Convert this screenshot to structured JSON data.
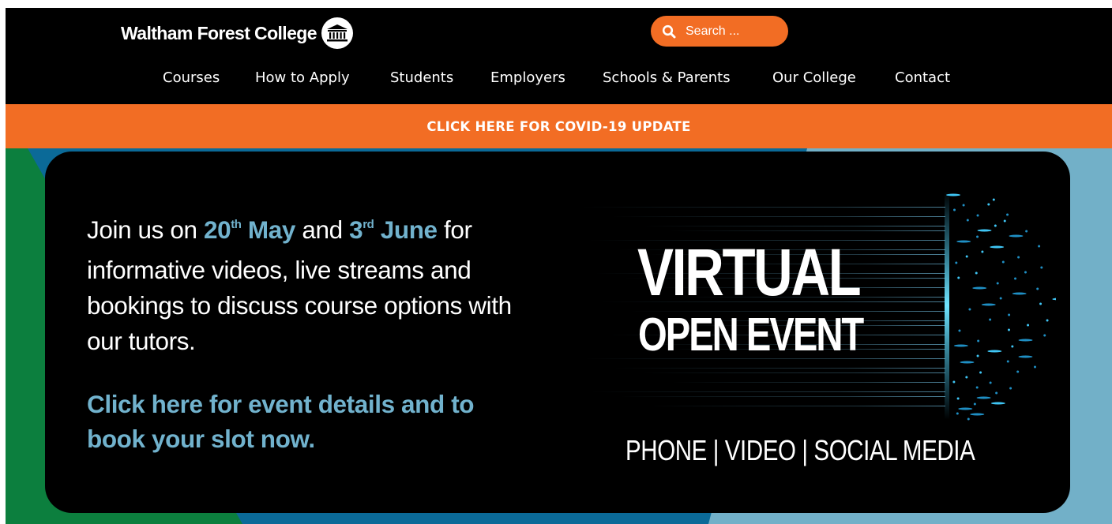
{
  "header": {
    "logo_text": "Waltham Forest College",
    "search_placeholder": "Search ..."
  },
  "nav": {
    "items": [
      "Courses",
      "How to Apply",
      "Students",
      "Employers",
      "Schools & Parents",
      "Our College",
      "Contact"
    ]
  },
  "covid_banner": {
    "label": "CLICK HERE FOR COVID-19 UPDATE"
  },
  "hero": {
    "intro_prefix": "Join us on ",
    "date1_day": "20",
    "date1_suffix": "th",
    "date1_month": " May",
    "connector": " and ",
    "date2_day": "3",
    "date2_suffix": "rd",
    "date2_month": " June",
    "intro_rest": " for informative videos, live streams and bookings to discuss course options with our tutors.",
    "cta": "Click here for event details and to book your slot now.",
    "event_line1": "VIRTUAL",
    "event_line2": "OPEN EVENT",
    "channels": "PHONE | VIDEO | SOCIAL MEDIA"
  },
  "colors": {
    "brand_orange": "#f26d24",
    "highlight_blue": "#71b2cd",
    "hero_green": "#0c7f3e",
    "hero_dark_blue": "#0b6a98",
    "hero_light_blue": "#72b0c8"
  }
}
